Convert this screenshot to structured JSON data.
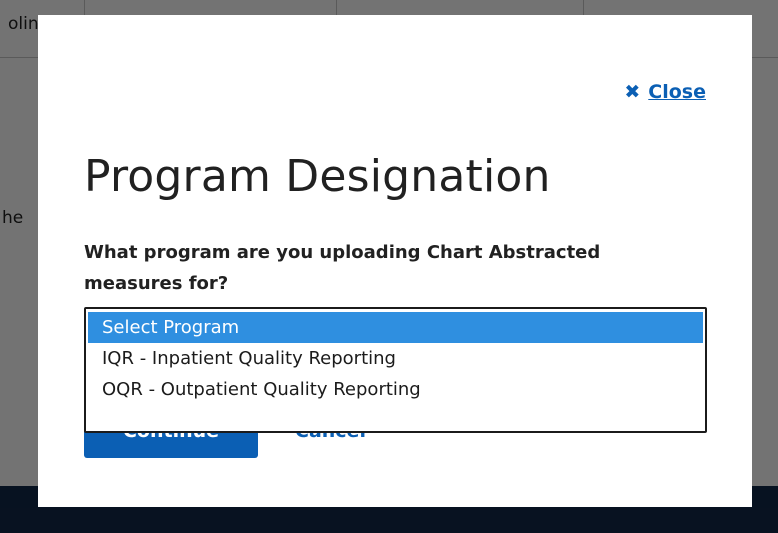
{
  "background": {
    "table_cell_fragment": "olin",
    "side_text_fragment": "he"
  },
  "modal": {
    "close_label": "Close",
    "close_icon": "close-x-icon",
    "title": "Program Designation",
    "question": "What program are you uploading Chart Abstracted measures for?",
    "select": {
      "selected": "Select Program",
      "options": [
        "Select Program",
        "IQR - Inpatient Quality Reporting",
        "OQR - Outpatient Quality Reporting"
      ]
    },
    "continue_label": "Continue",
    "cancel_label": "Cancel"
  },
  "colors": {
    "accent": "#0b5fb4",
    "highlight": "#2f8fe0",
    "footer": "#11284a"
  }
}
